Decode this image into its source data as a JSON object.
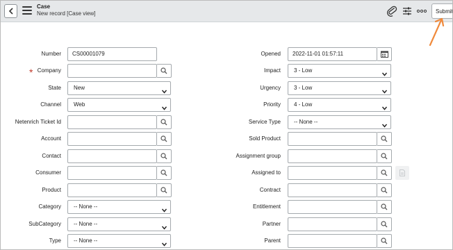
{
  "header": {
    "title": "Case",
    "subtitle": "New record [Case view]",
    "submit_label": "Submit",
    "icons": [
      "back-icon",
      "menu-icon",
      "paperclip-icon",
      "sliders-icon",
      "more-icon"
    ]
  },
  "left_fields": [
    {
      "label": "Number",
      "value": "CS00001079",
      "kind": "text"
    },
    {
      "label": "Company",
      "value": "",
      "kind": "lookup",
      "required": true
    },
    {
      "label": "State",
      "value": "New",
      "kind": "select"
    },
    {
      "label": "Channel",
      "value": "Web",
      "kind": "select"
    },
    {
      "label": "Netenrich Ticket Id",
      "value": "",
      "kind": "lookup"
    },
    {
      "label": "Account",
      "value": "",
      "kind": "lookup"
    },
    {
      "label": "Contact",
      "value": "",
      "kind": "lookup"
    },
    {
      "label": "Consumer",
      "value": "",
      "kind": "lookup"
    },
    {
      "label": "Product",
      "value": "",
      "kind": "lookup"
    },
    {
      "label": "Category",
      "value": "-- None --",
      "kind": "select"
    },
    {
      "label": "SubCategory",
      "value": "-- None --",
      "kind": "select"
    },
    {
      "label": "Type",
      "value": "-- None --",
      "kind": "select"
    }
  ],
  "right_fields": [
    {
      "label": "Opened",
      "value": "2022-11-01 01:57:11",
      "kind": "date"
    },
    {
      "label": "Impact",
      "value": "3 - Low",
      "kind": "select"
    },
    {
      "label": "Urgency",
      "value": "3 - Low",
      "kind": "select"
    },
    {
      "label": "Priority",
      "value": "4 - Low",
      "kind": "select"
    },
    {
      "label": "Service Type",
      "value": "-- None --",
      "kind": "select"
    },
    {
      "label": "Sold Product",
      "value": "",
      "kind": "lookup"
    },
    {
      "label": "Assignment group",
      "value": "",
      "kind": "lookup"
    },
    {
      "label": "Assigned to",
      "value": "",
      "kind": "lookup"
    },
    {
      "label": "Contract",
      "value": "",
      "kind": "lookup"
    },
    {
      "label": "Entitlement",
      "value": "",
      "kind": "lookup"
    },
    {
      "label": "Partner",
      "value": "",
      "kind": "lookup"
    },
    {
      "label": "Parent",
      "value": "",
      "kind": "lookup"
    }
  ],
  "colors": {
    "header_bg": "#e6e8ea",
    "required": "#c0392b",
    "arrow": "#f08a3c"
  }
}
